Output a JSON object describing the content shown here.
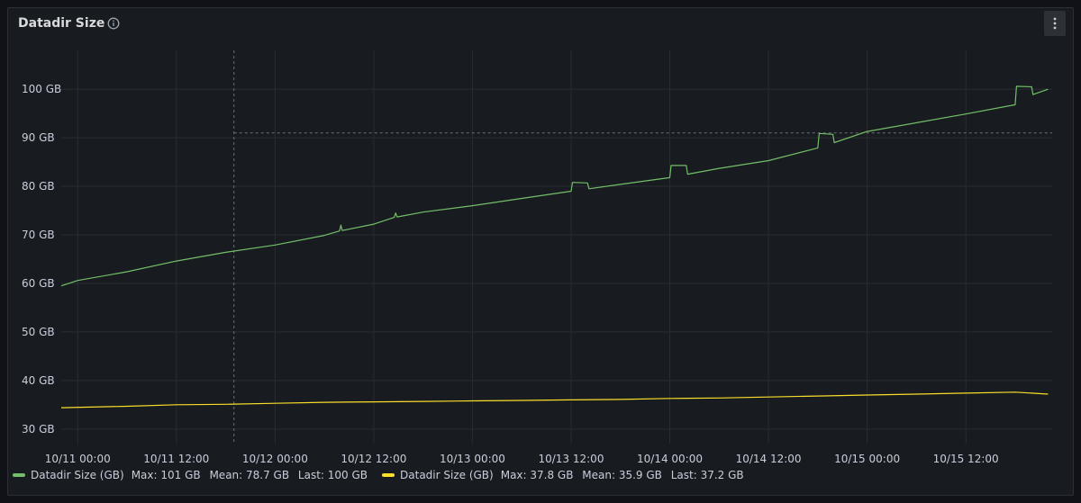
{
  "panel": {
    "title": "Datadir Size",
    "info_icon": "info-circle-icon",
    "menu_icon": "kebab-menu-icon"
  },
  "colors": {
    "background": "#181b1f",
    "grid": "#2a2c31",
    "series_green": "#73bf69",
    "series_yellow": "#fade2a"
  },
  "chart_data": {
    "type": "line",
    "title": "Datadir Size",
    "xlabel": "",
    "ylabel": "",
    "y_unit": "GB",
    "ylim": [
      27,
      108
    ],
    "y_ticks": [
      30,
      40,
      50,
      60,
      70,
      80,
      90,
      100
    ],
    "y_tick_labels": [
      "30 GB",
      "40 GB",
      "50 GB",
      "60 GB",
      "70 GB",
      "80 GB",
      "90 GB",
      "100 GB"
    ],
    "xlim": [
      "2024-10-10 22:00",
      "2024-10-15 22:30"
    ],
    "x_ticks": [
      "2024-10-11 00:00",
      "2024-10-11 12:00",
      "2024-10-12 00:00",
      "2024-10-12 12:00",
      "2024-10-13 00:00",
      "2024-10-13 12:00",
      "2024-10-14 00:00",
      "2024-10-14 12:00",
      "2024-10-15 00:00",
      "2024-10-15 12:00"
    ],
    "x_tick_labels": [
      "10/11 00:00",
      "10/11 12:00",
      "10/12 00:00",
      "10/12 12:00",
      "10/13 00:00",
      "10/13 12:00",
      "10/14 00:00",
      "10/14 12:00",
      "10/15 00:00",
      "10/15 12:00"
    ],
    "grid": true,
    "legend_position": "bottom-left",
    "crosshair": {
      "x": "2024-10-11 19:00",
      "y": 91
    },
    "series": [
      {
        "name": "Datadir Size (GB)",
        "color": "#73bf69",
        "stats": {
          "max": "Max: 101 GB",
          "mean": "Mean: 78.7 GB",
          "last": "Last: 100 GB"
        },
        "x": [
          "2024-10-10 22:00",
          "2024-10-11 00:00",
          "2024-10-11 06:00",
          "2024-10-11 12:00",
          "2024-10-11 18:00",
          "2024-10-12 00:00",
          "2024-10-12 06:00",
          "2024-10-12 07:50",
          "2024-10-12 08:00",
          "2024-10-12 08:10",
          "2024-10-12 12:00",
          "2024-10-12 14:30",
          "2024-10-12 14:40",
          "2024-10-12 14:50",
          "2024-10-12 18:00",
          "2024-10-13 00:00",
          "2024-10-13 06:00",
          "2024-10-13 12:00",
          "2024-10-13 12:10",
          "2024-10-13 14:00",
          "2024-10-13 14:10",
          "2024-10-13 18:00",
          "2024-10-14 00:00",
          "2024-10-14 00:10",
          "2024-10-14 02:00",
          "2024-10-14 02:10",
          "2024-10-14 06:00",
          "2024-10-14 12:00",
          "2024-10-14 18:00",
          "2024-10-14 18:10",
          "2024-10-14 19:50",
          "2024-10-14 20:00",
          "2024-10-15 00:00",
          "2024-10-15 06:00",
          "2024-10-15 12:00",
          "2024-10-15 18:00",
          "2024-10-15 18:10",
          "2024-10-15 20:00",
          "2024-10-15 20:10",
          "2024-10-15 22:00"
        ],
        "values": [
          59.5,
          60.6,
          62.4,
          64.6,
          66.4,
          67.9,
          69.9,
          70.8,
          72.0,
          70.9,
          72.2,
          73.6,
          74.5,
          73.7,
          74.7,
          76.0,
          77.5,
          79.0,
          80.8,
          80.7,
          79.5,
          80.4,
          81.8,
          84.3,
          84.3,
          82.5,
          83.7,
          85.3,
          87.9,
          90.9,
          90.7,
          89.0,
          91.3,
          93.1,
          94.9,
          96.8,
          100.6,
          100.5,
          98.9,
          100.0
        ]
      },
      {
        "name": "Datadir Size (GB)",
        "color": "#fade2a",
        "stats": {
          "max": "Max: 37.8 GB",
          "mean": "Mean: 35.9 GB",
          "last": "Last: 37.2 GB"
        },
        "x": [
          "2024-10-10 22:00",
          "2024-10-11 06:00",
          "2024-10-11 12:00",
          "2024-10-11 18:00",
          "2024-10-12 00:00",
          "2024-10-12 06:00",
          "2024-10-12 12:00",
          "2024-10-12 18:00",
          "2024-10-13 00:00",
          "2024-10-13 06:00",
          "2024-10-13 12:00",
          "2024-10-13 18:00",
          "2024-10-14 00:00",
          "2024-10-14 06:00",
          "2024-10-14 12:00",
          "2024-10-14 18:00",
          "2024-10-15 00:00",
          "2024-10-15 06:00",
          "2024-10-15 12:00",
          "2024-10-15 18:00",
          "2024-10-15 22:00"
        ],
        "values": [
          34.4,
          34.7,
          35.0,
          35.1,
          35.3,
          35.5,
          35.6,
          35.7,
          35.8,
          35.9,
          36.0,
          36.1,
          36.3,
          36.4,
          36.6,
          36.8,
          37.0,
          37.2,
          37.4,
          37.6,
          37.2
        ]
      }
    ]
  }
}
